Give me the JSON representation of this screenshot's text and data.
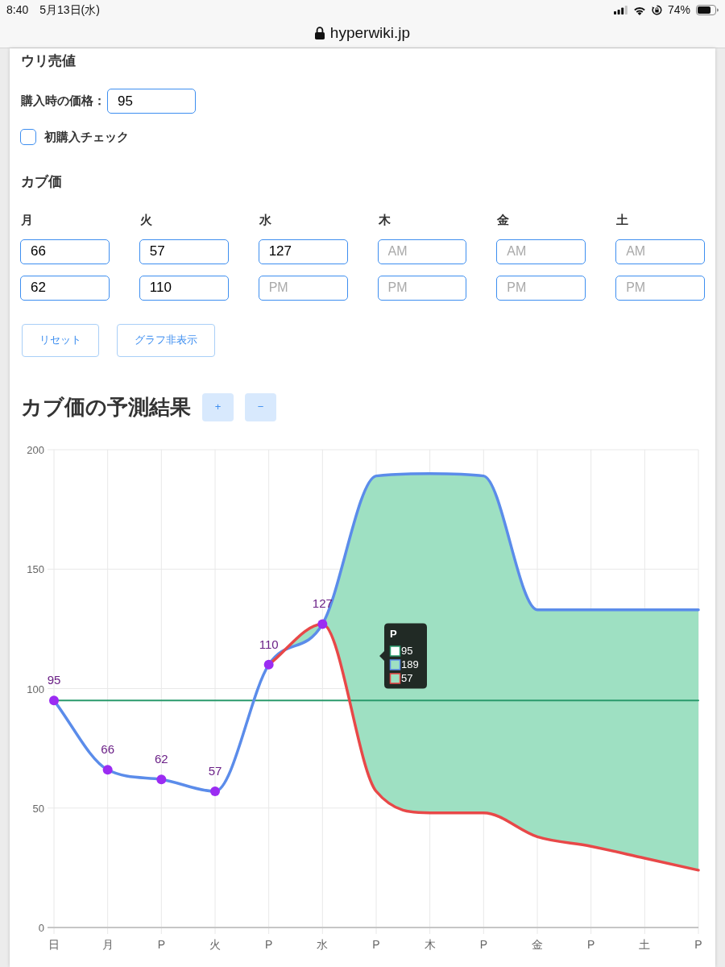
{
  "status_bar": {
    "time": "8:40",
    "date": "5月13日(水)",
    "battery": "74%",
    "url": "hyperwiki.jp"
  },
  "sell_section": {
    "title": "ウリ売値",
    "purchase_price": {
      "label": "購入時の価格：",
      "value": "95"
    },
    "first_buy": {
      "label": "初購入チェック",
      "checked": false
    }
  },
  "prices_section": {
    "title": "カブ価",
    "days": [
      {
        "label": "月",
        "am": {
          "value": "66"
        },
        "pm": {
          "value": "62"
        }
      },
      {
        "label": "火",
        "am": {
          "value": "57"
        },
        "pm": {
          "value": "110"
        }
      },
      {
        "label": "水",
        "am": {
          "value": "127"
        },
        "pm": {
          "placeholder": "PM"
        }
      },
      {
        "label": "木",
        "am": {
          "placeholder": "AM"
        },
        "pm": {
          "placeholder": "PM"
        }
      },
      {
        "label": "金",
        "am": {
          "placeholder": "AM"
        },
        "pm": {
          "placeholder": "PM"
        }
      },
      {
        "label": "土",
        "am": {
          "placeholder": "AM"
        },
        "pm": {
          "placeholder": "PM"
        }
      }
    ]
  },
  "buttons": [
    "リセット",
    "グラフ非表示"
  ],
  "forecast": {
    "title": "カブ価の予測結果",
    "zoom_buttons": [
      "+",
      "−"
    ],
    "chart_data": {
      "type": "line",
      "categories": [
        "日",
        "月",
        "P",
        "火",
        "P",
        "水",
        "P",
        "木",
        "P",
        "金",
        "P",
        "土",
        "P"
      ],
      "ylim": [
        0,
        200
      ],
      "yticks": [
        0,
        50,
        100,
        150,
        200
      ],
      "grid": true,
      "series": [
        {
          "color": "#2a9a6c",
          "values": [
            95,
            95,
            95,
            95,
            95,
            95,
            95,
            95,
            95,
            95,
            95,
            95,
            95
          ]
        },
        {
          "color": "#5b8cea",
          "values": [
            95,
            66,
            62,
            57,
            110,
            127,
            189,
            190,
            189,
            133,
            133,
            133,
            133
          ],
          "value_labels": [
            "95",
            "66",
            "62",
            "57",
            "110",
            "127",
            null,
            null,
            null,
            null,
            null,
            null,
            null
          ]
        },
        {
          "color": "#e84848",
          "values": [
            null,
            null,
            null,
            null,
            110,
            127,
            57,
            48,
            48,
            38,
            34,
            29,
            24
          ]
        }
      ]
    },
    "tooltip": {
      "title": "P",
      "items": [
        {
          "value": "95",
          "color": "#2a9a6c",
          "filled": false
        },
        {
          "value": "189",
          "color": "#5b8cea",
          "filled": true
        },
        {
          "value": "57",
          "color": "#e84848",
          "filled": true
        }
      ]
    }
  }
}
